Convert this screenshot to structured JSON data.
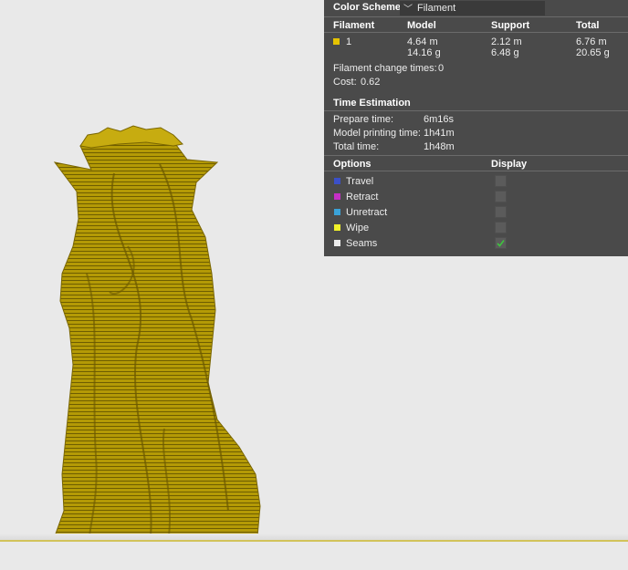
{
  "color_scheme": {
    "label": "Color Scheme",
    "selected": "Filament"
  },
  "filament_table": {
    "headers": [
      "Filament",
      "Model",
      "Support",
      "Total"
    ],
    "rows": [
      {
        "swatch_color": "#e5c300",
        "filament": "1",
        "model_length": "4.64 m",
        "model_weight": "14.16 g",
        "support_length": "2.12 m",
        "support_weight": "6.48 g",
        "total_length": "6.76 m",
        "total_weight": "20.65 g"
      }
    ]
  },
  "filament_change": {
    "label": "Filament change times:",
    "value": "0"
  },
  "cost": {
    "label": "Cost:",
    "value": "0.62"
  },
  "time_estimation": {
    "title": "Time Estimation",
    "prepare_label": "Prepare time:",
    "prepare_value": "6m16s",
    "model_label": "Model printing time:",
    "model_value": "1h41m",
    "total_label": "Total time:",
    "total_value": "1h48m"
  },
  "options": {
    "header_options": "Options",
    "header_display": "Display",
    "items": [
      {
        "label": "Travel",
        "color": "#3b50c8",
        "checked": false
      },
      {
        "label": "Retract",
        "color": "#c62fc6",
        "checked": false
      },
      {
        "label": "Unretract",
        "color": "#3aa2d8",
        "checked": false
      },
      {
        "label": "Wipe",
        "color": "#f1f12a",
        "checked": false
      },
      {
        "label": "Seams",
        "color": "#ececec",
        "checked": true
      }
    ]
  },
  "model_color": "#a99000"
}
